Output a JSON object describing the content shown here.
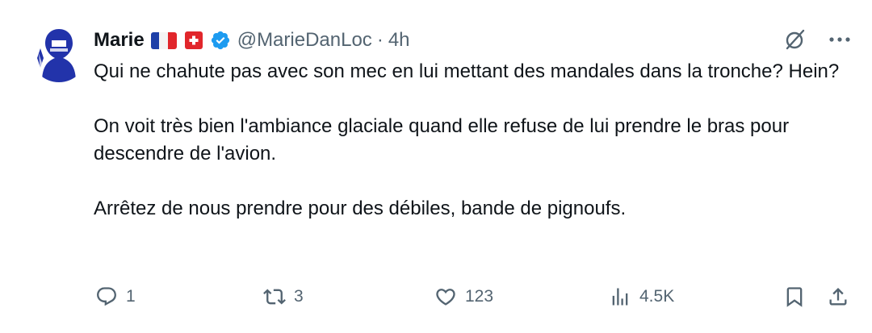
{
  "tweet": {
    "author_name": "Marie",
    "handle": "@MarieDanLoc",
    "separator": "·",
    "time": "4h",
    "paragraphs": [
      "Qui ne chahute pas avec son mec en lui mettant des mandales dans la tronche? Hein?",
      "On voit très bien l'ambiance glaciale quand elle refuse de lui prendre le bras pour descendre de l'avion.",
      "Arrêtez de nous prendre pour des débiles, bande de pignoufs."
    ]
  },
  "actions": {
    "replies": "1",
    "reposts": "3",
    "likes": "123",
    "views": "4.5K"
  },
  "icons": {
    "flag": "france-flag-icon",
    "badge": "swiss-cross-icon",
    "verified": "verified-badge-icon",
    "grok": "grok-icon",
    "more": "more-icon",
    "reply": "reply-icon",
    "repost": "repost-icon",
    "like": "heart-icon",
    "views": "views-icon",
    "bookmark": "bookmark-icon",
    "share": "share-icon"
  },
  "colors": {
    "text": "#0f1419",
    "secondary": "#536471",
    "verified": "#1d9bf0",
    "avatar": "#2233aa",
    "swiss_red": "#e1262b",
    "flag_blue": "#1d3fa8",
    "flag_red": "#e1262b"
  }
}
